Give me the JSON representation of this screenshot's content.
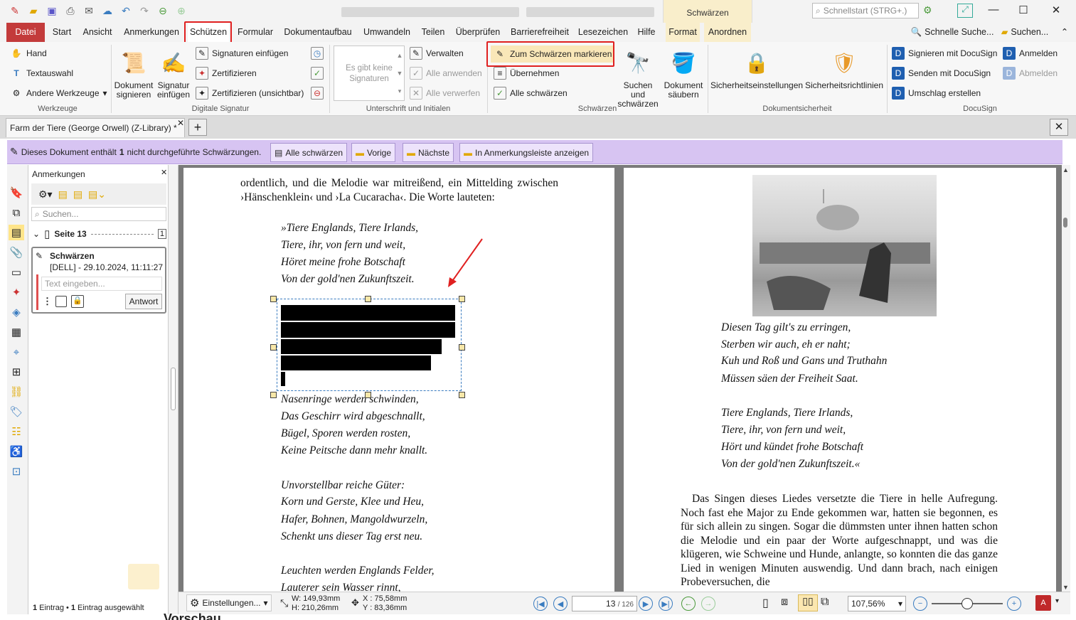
{
  "titlebar": {
    "context_tab_group": "Schwärzen",
    "search_placeholder": "Schnellstart (STRG+.)",
    "window_controls": [
      "minimize",
      "maximize",
      "close"
    ]
  },
  "menu": {
    "items": [
      "Datei",
      "Start",
      "Ansicht",
      "Anmerkungen",
      "Schützen",
      "Formular",
      "Dokumentaufbau",
      "Umwandeln",
      "Teilen",
      "Überprüfen",
      "Barrierefreiheit",
      "Lesezeichen",
      "Hilfe",
      "Format",
      "Anordnen"
    ],
    "active": "Schützen",
    "quick_search": "Schnelle Suche...",
    "search": "Suchen..."
  },
  "ribbon": {
    "werkzeuge": {
      "label": "Werkzeuge",
      "hand": "Hand",
      "text": "Textauswahl",
      "other": "Andere Werkzeuge"
    },
    "signatur": {
      "label": "Digitale Signatur",
      "sign": "Dokument signieren",
      "insert": "Signatur einfügen",
      "add": "Signaturen einfügen",
      "certify": "Zertifizieren",
      "certify_invisible": "Zertifizieren (unsichtbar)"
    },
    "initialen": {
      "label": "Unterschrift und Initialen",
      "empty": "Es gibt keine Signaturen",
      "manage": "Verwalten",
      "apply_all": "Alle anwenden",
      "discard_all": "Alle verwerfen"
    },
    "schwaerzen": {
      "label": "Schwärzen",
      "mark": "Zum Schwärzen markieren",
      "apply": "Übernehmen",
      "all": "Alle schwärzen",
      "search_redact": "Suchen und schwärzen",
      "sanitize": "Dokument säubern"
    },
    "sicherheit": {
      "label": "Dokumentsicherheit",
      "settings": "Sicherheitseinstellungen",
      "policies": "Sicherheitsrichtlinien"
    },
    "docusign": {
      "label": "DocuSign",
      "sign": "Signieren mit DocuSign",
      "send": "Senden mit DocuSign",
      "envelope": "Umschlag erstellen",
      "login": "Anmelden",
      "logout": "Abmelden"
    }
  },
  "tab": {
    "title": "Farm der Tiere (George Orwell) (Z-Library) *"
  },
  "notification": {
    "pre": "Dieses Dokument enthält",
    "count": "1",
    "post": "nicht durchgeführte Schwärzungen.",
    "buttons": [
      "Alle schwärzen",
      "Vorige",
      "Nächste",
      "In Anmerkungsleiste anzeigen"
    ]
  },
  "annotations": {
    "title": "Anmerkungen",
    "search_placeholder": "Suchen...",
    "page_label": "Seite 13",
    "page_count": "1",
    "item_title": "Schwärzen",
    "item_meta": "[DELL] - 29.10.2024, 11:11:27",
    "reply_placeholder": "Text eingeben...",
    "reply_button": "Antwort",
    "footer_count": "1",
    "footer_text1": "Eintrag •",
    "footer_sel": "1",
    "footer_text2": "Eintrag ausgewählt"
  },
  "page_left": {
    "para": "ordentlich, und die Melodie war mitreißend, ein Mittelding zwischen ›Hänschenklein‹ und ›La Cucaracha‹. Die Worte lauteten:",
    "verses": [
      "»Tiere Englands, Tiere Irlands,",
      "Tiere, ihr, von fern und weit,",
      "Höret meine frohe Botschaft",
      "Von der gold'nen Zukunftszeit.",
      "Nasenringe werden schwinden,",
      "Das Geschirr wird abgeschnallt,",
      "Bügel, Sporen werden rosten,",
      "Keine Peitsche dann mehr knallt.",
      "Unvorstellbar reiche Güter:",
      "Korn und Gerste, Klee und Heu,",
      "Hafer, Bohnen, Mangoldwurzeln,",
      "Schenkt uns dieser Tag erst neu.",
      "Leuchten werden Englands Felder,",
      "Lauterer sein Wasser rinnt,"
    ]
  },
  "page_right": {
    "verses": [
      "Diesen Tag gilt's zu erringen,",
      "Sterben wir auch, eh er naht;",
      "Kuh und Roß und Gans und Truthahn",
      "Müssen säen der Freiheit Saat.",
      "Tiere Englands, Tiere Irlands,",
      "Tiere, ihr, von fern und weit,",
      "Hört und kündet frohe Botschaft",
      "Von der gold'nen Zukunftszeit.«"
    ],
    "para": "Das Singen dieses Liedes versetzte die Tiere in helle Aufregung. Noch fast ehe Major zu Ende gekommen war, hatten sie begonnen, es für sich allein zu singen. Sogar die dümmsten unter ihnen hatten schon die Melodie und ein paar der Worte aufgeschnappt, und was die klügeren, wie Schweine und Hunde, anlangte, so konnten die das ganze Lied in wenigen Minuten auswendig. Und dann brach, nach einigen Probeversuchen, die"
  },
  "statusbar": {
    "settings": "Einstellungen...",
    "width": "W: 149,93mm",
    "height": "H: 210,26mm",
    "x": "X : 75,58mm",
    "y": "Y : 83,36mm",
    "page": "13",
    "total": "/ 126",
    "zoom": "107,56%",
    "zoom_slider_fraction": 0.5
  },
  "bottom_text": "Vorschau"
}
